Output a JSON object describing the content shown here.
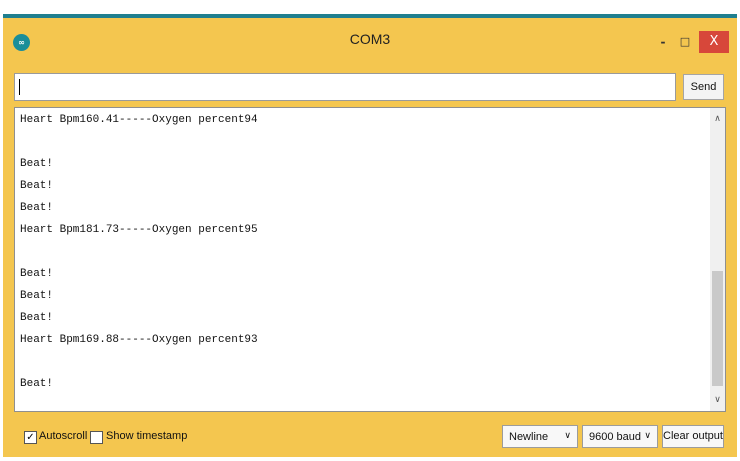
{
  "window": {
    "title": "COM3",
    "app_icon": "arduino-icon",
    "controls": {
      "minimize": "-",
      "maximize": "□",
      "close": "X"
    }
  },
  "input": {
    "value": "",
    "send_label": "Send"
  },
  "output": {
    "lines": [
      "Heart Bpm160.41-----Oxygen percent94",
      "",
      "Beat!",
      "Beat!",
      "Beat!",
      "Heart Bpm181.73-----Oxygen percent95",
      "",
      "Beat!",
      "Beat!",
      "Beat!",
      "Heart Bpm169.88-----Oxygen percent93",
      "",
      "Beat!"
    ],
    "scroll_up": "∧",
    "scroll_down": "∨"
  },
  "footer": {
    "autoscroll_label": "Autoscroll",
    "autoscroll_checked": "✓",
    "timestamp_label": "Show timestamp",
    "line_ending": "Newline",
    "baud_rate": "9600 baud",
    "select_chevron": "∨",
    "clear_label": "Clear output"
  },
  "colors": {
    "window_border": "#f4c64f",
    "title_accent": "#1f7f8f",
    "close_button": "#d7473a"
  }
}
